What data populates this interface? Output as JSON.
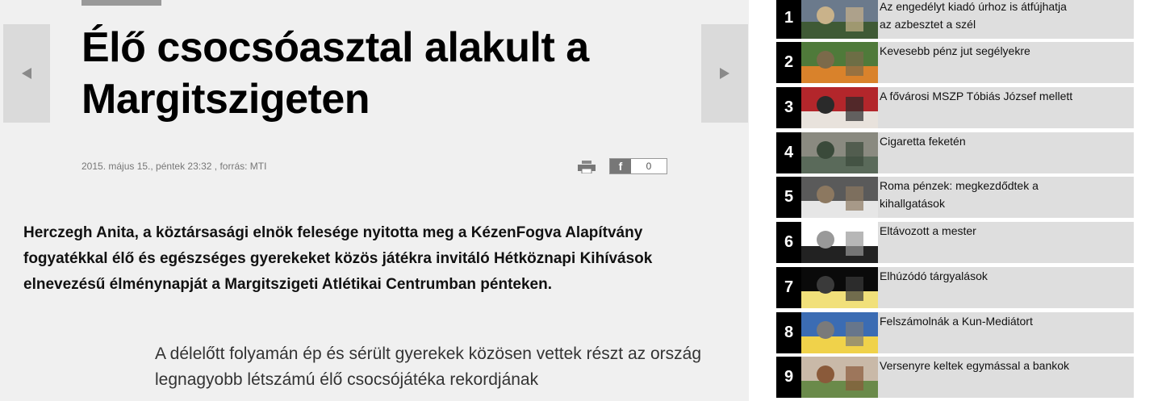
{
  "article": {
    "title": "Élő csocsóasztal alakult a Margitszigeten",
    "meta": "2015. május 15., péntek 23:32 , forrás: MTI",
    "share_count": "0",
    "facebook_letter": "f",
    "lead": "Herczegh Anita, a köztársasági elnök felesége nyitotta meg a KézenFogva Alapítvány fogyatékkal élő és egészséges gyerekeket közös játékra invitáló Hétköznapi Kihívások elnevezésű élménynapját a Margitszigeti Atlétikai Centrumban pénteken.",
    "body": "A délelőtt folyamán ép és sérült gyerekek közösen vettek részt az ország legnagyobb létszámú élő csocsójátéka rekordjának"
  },
  "navigation": {
    "prev_icon": "triangle-left-icon",
    "next_icon": "triangle-right-icon"
  },
  "sidebar": {
    "items": [
      {
        "num": "1",
        "title": "Az engedélyt kiadó úrhoz is átfújhatja az azbesztet a szél",
        "thumb_colors": [
          "#6b7a8c",
          "#3f5a35",
          "#c9b28a"
        ]
      },
      {
        "num": "2",
        "title": "Kevesebb pénz jut segélyekre",
        "thumb_colors": [
          "#4f7a3a",
          "#d9822b",
          "#7b6a4a"
        ]
      },
      {
        "num": "3",
        "title": "A fővárosi MSZP Tóbiás József mellett",
        "thumb_colors": [
          "#b3262b",
          "#e8e2dc",
          "#2a2a2a"
        ]
      },
      {
        "num": "4",
        "title": "Cigaretta feketén",
        "thumb_colors": [
          "#8a8a80",
          "#5a6a5a",
          "#3a4a3a"
        ]
      },
      {
        "num": "5",
        "title": "Roma pénzek: megkezdődtek a kihallgatások",
        "thumb_colors": [
          "#5a5a5a",
          "#e6e6e6",
          "#8c7860"
        ]
      },
      {
        "num": "6",
        "title": "Eltávozott a mester",
        "thumb_colors": [
          "#ffffff",
          "#222222",
          "#999999"
        ]
      },
      {
        "num": "7",
        "title": "Elhúzódó tárgyalások",
        "thumb_colors": [
          "#0a0a0a",
          "#f1e07a",
          "#3a3a3a"
        ]
      },
      {
        "num": "8",
        "title": "Felszámolnák a Kun-Mediátort",
        "thumb_colors": [
          "#3b6cb3",
          "#f0d24a",
          "#7a7a7a"
        ]
      },
      {
        "num": "9",
        "title": "Versenyre keltek egymással a bankok",
        "thumb_colors": [
          "#c9b9a8",
          "#6a8a4a",
          "#8a5a3a"
        ]
      }
    ]
  }
}
